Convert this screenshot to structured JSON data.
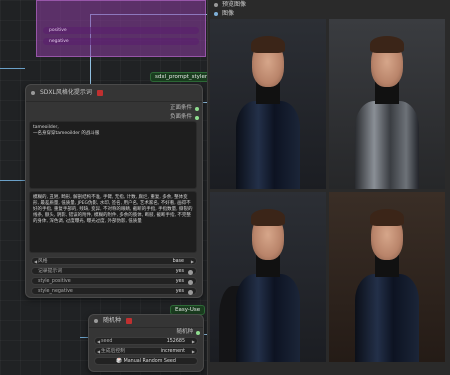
{
  "canvas": {
    "group_rows": [
      "positive",
      "negative"
    ]
  },
  "styler_node": {
    "tag": "sdxl_prompt_styler",
    "title": "SDXL风格化提示词",
    "outputs": [
      "正面条件",
      "负面条件"
    ],
    "positive_text": "tameoilder,\n一名身穿穿tameoilder 的战斗服",
    "negative_text": "模糊的, 丑陋, 畸形, 解剖结构不准, 手臂, 无指, 计数, 腐烂, 重复, 多余, 整体变形, 最差质量, 低质量, JPEG伪影, 水印, 签名, 用户名, 艺术家名, 不好看, 画得不好的手指, 重复手部的, 残缺, 变异, 不对称的眼睛, 截断的手指, 手指数量, 撕裂的线条, 额头, 阴影, 错误的附件, 模糊的附件, 多余的肢体, 断肢, 截断手指, 不完整的身体, 深色调, 过度曝光, 曝光过度, 外部伪影, 低质量",
    "widgets": [
      {
        "label": "风格",
        "value": "base"
      },
      {
        "label": "记录提示词",
        "value": "yes"
      },
      {
        "label": "style_positive",
        "value": "yes"
      },
      {
        "label": "style_negative",
        "value": "yes"
      }
    ]
  },
  "seed_node": {
    "tag": "Easy-Use",
    "title": "随机种",
    "output": "随机种",
    "seed_label": "seed",
    "seed_value": "152685",
    "control_label": "生成后控制",
    "control_value": "increment",
    "button_label": "Manual Random Seed"
  },
  "preview_node": {
    "title": "预览图像",
    "output_label": "图像",
    "images": [
      {
        "armor": "dark-blue"
      },
      {
        "armor": "silver"
      },
      {
        "armor": "dark-blue-cape"
      },
      {
        "armor": "dark-blue"
      }
    ]
  }
}
